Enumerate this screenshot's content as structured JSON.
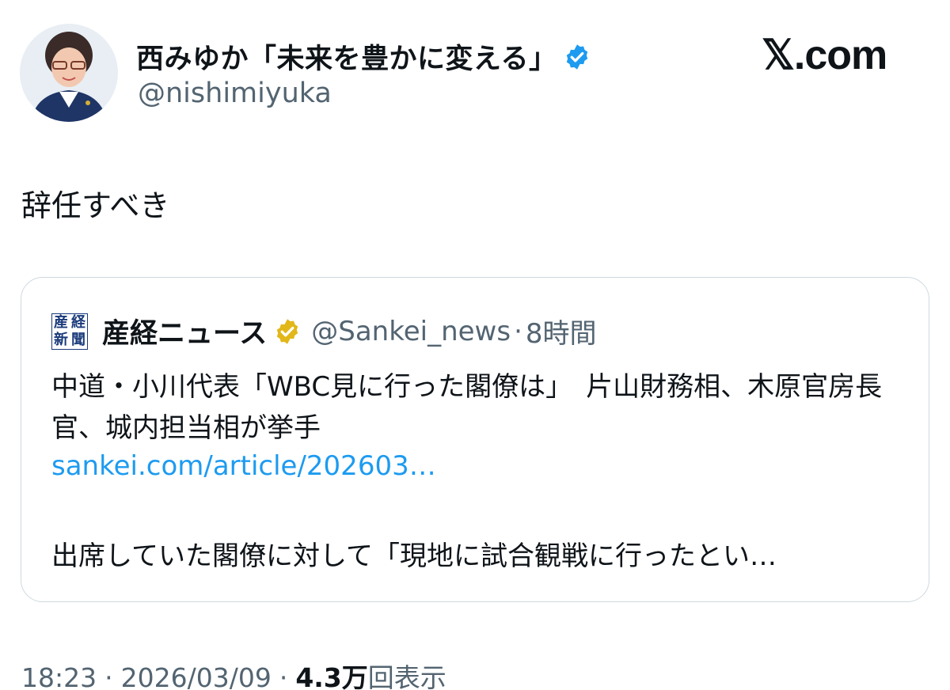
{
  "author": {
    "name": "西みゆか「未来を豊かに変える」",
    "handle": "@nishimiyuka",
    "verified_color": "#1d9bf0"
  },
  "site_logo": "𝕏.com",
  "tweet": {
    "text": "辞任すべき"
  },
  "quote": {
    "logo_chars": [
      "産",
      "経",
      "新",
      "聞"
    ],
    "name": "産経ニュース",
    "verified_color": "#e2b719",
    "handle": "@Sankei_news",
    "dot": "·",
    "time": "8時間",
    "text": "中道・小川代表「WBC見に行った閣僚は」　片山財務相、木原官房長官、城内担当相が挙手",
    "link": "sankei.com/article/202603…",
    "excerpt": "出席していた閣僚に対して「現地に試合観戦に行ったとい…"
  },
  "meta": {
    "time": "18:23",
    "sep1": "·",
    "date": "2026/03/09",
    "sep2": "·",
    "views_count": "4.3万",
    "views_label": "回表示"
  }
}
